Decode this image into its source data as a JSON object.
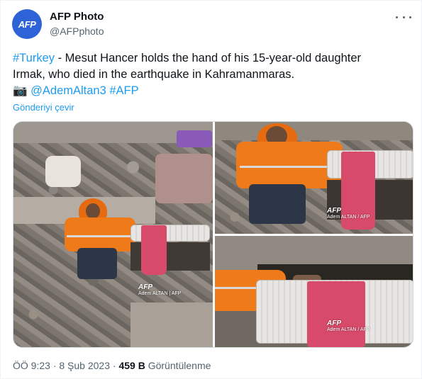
{
  "author": {
    "avatar_text": "AFP",
    "display_name": "AFP Photo",
    "handle": "@AFPphoto"
  },
  "tweet": {
    "hashtag_country": "#Turkey",
    "text_line1": " - Mesut Hancer holds the hand of his 15-year-old daughter",
    "text_line2": "Irmak, who died in the earthquake in Kahramanmaras.",
    "camera_emoji": "📷",
    "mention": "@AdemAltan3",
    "hashtag_afp": "#AFP",
    "translate_label": "Gönderiyi çevir"
  },
  "media": {
    "photos": [
      {
        "watermark_logo": "AFP",
        "watermark_credit": "Adem ALTAN | AFP"
      },
      {
        "watermark_logo": "AFP",
        "watermark_credit": "Adem ALTAN / AFP"
      },
      {
        "watermark_logo": "AFP",
        "watermark_credit": "Adem ALTAN / AFP"
      }
    ]
  },
  "footer": {
    "time": "ÖÖ 9:23",
    "separator": "·",
    "date": "8 Şub 2023",
    "views_count": "459 B",
    "views_label": "Görüntülenme"
  },
  "colors": {
    "link": "#1d9bf0",
    "secondary_text": "#536471",
    "avatar_bg": "#2e63d8"
  }
}
